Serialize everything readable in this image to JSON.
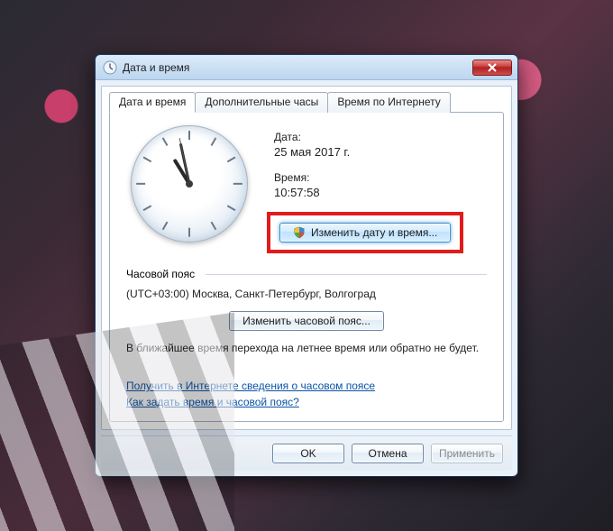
{
  "window": {
    "title": "Дата и время"
  },
  "tabs": [
    {
      "label": "Дата и время",
      "active": true
    },
    {
      "label": "Дополнительные часы",
      "active": false
    },
    {
      "label": "Время по Интернету",
      "active": false
    }
  ],
  "datetime": {
    "date_label": "Дата:",
    "date_value": "25 мая 2017 г.",
    "time_label": "Время:",
    "time_value": "10:57:58",
    "change_button": "Изменить дату и время...",
    "clock": {
      "hours": 10,
      "minutes": 57,
      "seconds": 58
    }
  },
  "timezone": {
    "header": "Часовой пояс",
    "value": "(UTC+03:00) Москва, Санкт-Петербург, Волгоград",
    "change_button": "Изменить часовой пояс..."
  },
  "dst_notice": "В ближайшее время перехода на летнее время или обратно не будет.",
  "links": {
    "online_tz": "Получить в Интернете сведения о часовом поясе",
    "howto": "Как задать время и часовой пояс?"
  },
  "footer": {
    "ok": "OK",
    "cancel": "Отмена",
    "apply": "Применить"
  }
}
